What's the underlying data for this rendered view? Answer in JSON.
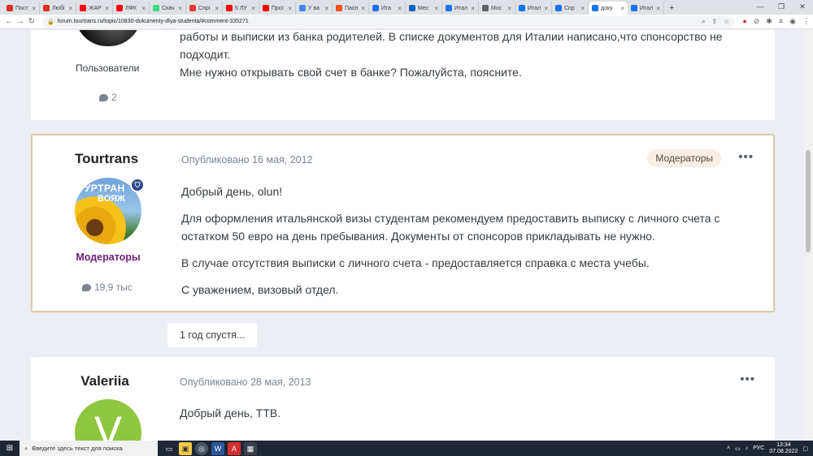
{
  "browser": {
    "tabs": [
      {
        "label": "Пост",
        "color": "#d93025"
      },
      {
        "label": "Любі",
        "color": "#d93025"
      },
      {
        "label": "ЖАР",
        "color": "#ff0000"
      },
      {
        "label": "ЛФК",
        "color": "#ff0000"
      },
      {
        "label": "Скач",
        "color": "#3ddc84"
      },
      {
        "label": "Спрі",
        "color": "#e53935"
      },
      {
        "label": "5 ЛУ",
        "color": "#ff0000"
      },
      {
        "label": "Прої",
        "color": "#ff0000"
      },
      {
        "label": "У ва",
        "color": "#4285f4"
      },
      {
        "label": "Пасп",
        "color": "#f4511e"
      },
      {
        "label": "Ита",
        "color": "#1a73e8"
      },
      {
        "label": "Мес",
        "color": "#1565c0"
      },
      {
        "label": "Итал",
        "color": "#1a73e8"
      },
      {
        "label": "Мос",
        "color": "#5f6368"
      },
      {
        "label": "Итал",
        "color": "#1a73e8"
      },
      {
        "label": "Спр",
        "color": "#1a73e8"
      },
      {
        "label": "доку",
        "color": "#1a73e8"
      },
      {
        "label": "Итал",
        "color": "#1a73e8"
      }
    ],
    "active_tab_index": 16,
    "url": "forum.tourtrans.ru/topic/10830-dokumenty-dlya-studenta/#comment-335271"
  },
  "post1": {
    "text_line1": "работы и выписки из банка родителей. В списке документов для Италии написано,что спонсорство не подходит.",
    "text_line2": "Мне нужно открывать свой счет в банке? Пожалуйста, поясните.",
    "group": "Пользователи",
    "count": "2"
  },
  "post2": {
    "author": "Tourtrans",
    "published": "Опубликовано 16 мая, 2012",
    "badge": "Модераторы",
    "avatar_text1": "ТУРТРАН",
    "avatar_text2": "ВОЯЖ",
    "group": "Модераторы",
    "count": "19,9 тыс",
    "p1": "Добрый день, olun!",
    "p2": "Для оформления итальянской визы студентам рекомендуем предоставить выписку с личного счета с остатком 50 евро на день пребывания. Документы от спонсоров прикладывать не нужно.",
    "p3": "В случае отсутствия выписки с личного счета - предоставляется справка с места учебы.",
    "p4": "С уважением, визовый отдел."
  },
  "time_gap": "1 год спустя...",
  "post3": {
    "author": "Valeriia",
    "published": "Опубликовано 28 мая, 2013",
    "avatar_letter": "V",
    "p1": "Добрый день, ТТВ."
  },
  "taskbar": {
    "search_placeholder": "Введите здесь текст для поиска",
    "lang": "РУС",
    "time": "13:34",
    "date": "07.08.2022"
  }
}
